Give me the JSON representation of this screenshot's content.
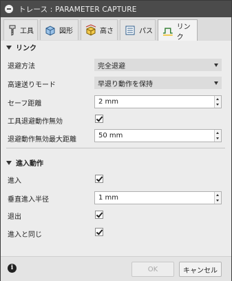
{
  "window": {
    "title": "トレース : PARAMETER CAPTURE"
  },
  "tabs": [
    {
      "label": "工具",
      "icon": "tool-icon",
      "active": false
    },
    {
      "label": "図形",
      "icon": "geometry-icon",
      "active": false
    },
    {
      "label": "高さ",
      "icon": "heights-icon",
      "active": false
    },
    {
      "label": "パス",
      "icon": "passes-icon",
      "active": false
    },
    {
      "label": "リンク",
      "icon": "linking-icon",
      "active": true
    }
  ],
  "linking": {
    "header": "リンク",
    "retraction_policy": {
      "label": "退避方法",
      "value": "完全退避"
    },
    "high_feed_mode": {
      "label": "高速送りモード",
      "value": "早退り動作を保持"
    },
    "safe_distance": {
      "label": "セーフ距離",
      "value": "2 mm"
    },
    "no_engagement_retract": {
      "label": "工具退避動作無効",
      "checked": true
    },
    "max_stay_down_distance": {
      "label": "退避動作無効最大距離",
      "value": "50 mm"
    }
  },
  "lead": {
    "header": "進入動作",
    "lead_in": {
      "label": "進入",
      "checked": true
    },
    "vertical_lead_in_radius": {
      "label": "垂直進入半径",
      "value": "1 mm"
    },
    "lead_out": {
      "label": "退出",
      "checked": true
    },
    "same_as_lead_in": {
      "label": "進入と同じ",
      "checked": true
    }
  },
  "footer": {
    "info_glyph": "i",
    "ok_label": "OK",
    "cancel_label": "キャンセル"
  }
}
